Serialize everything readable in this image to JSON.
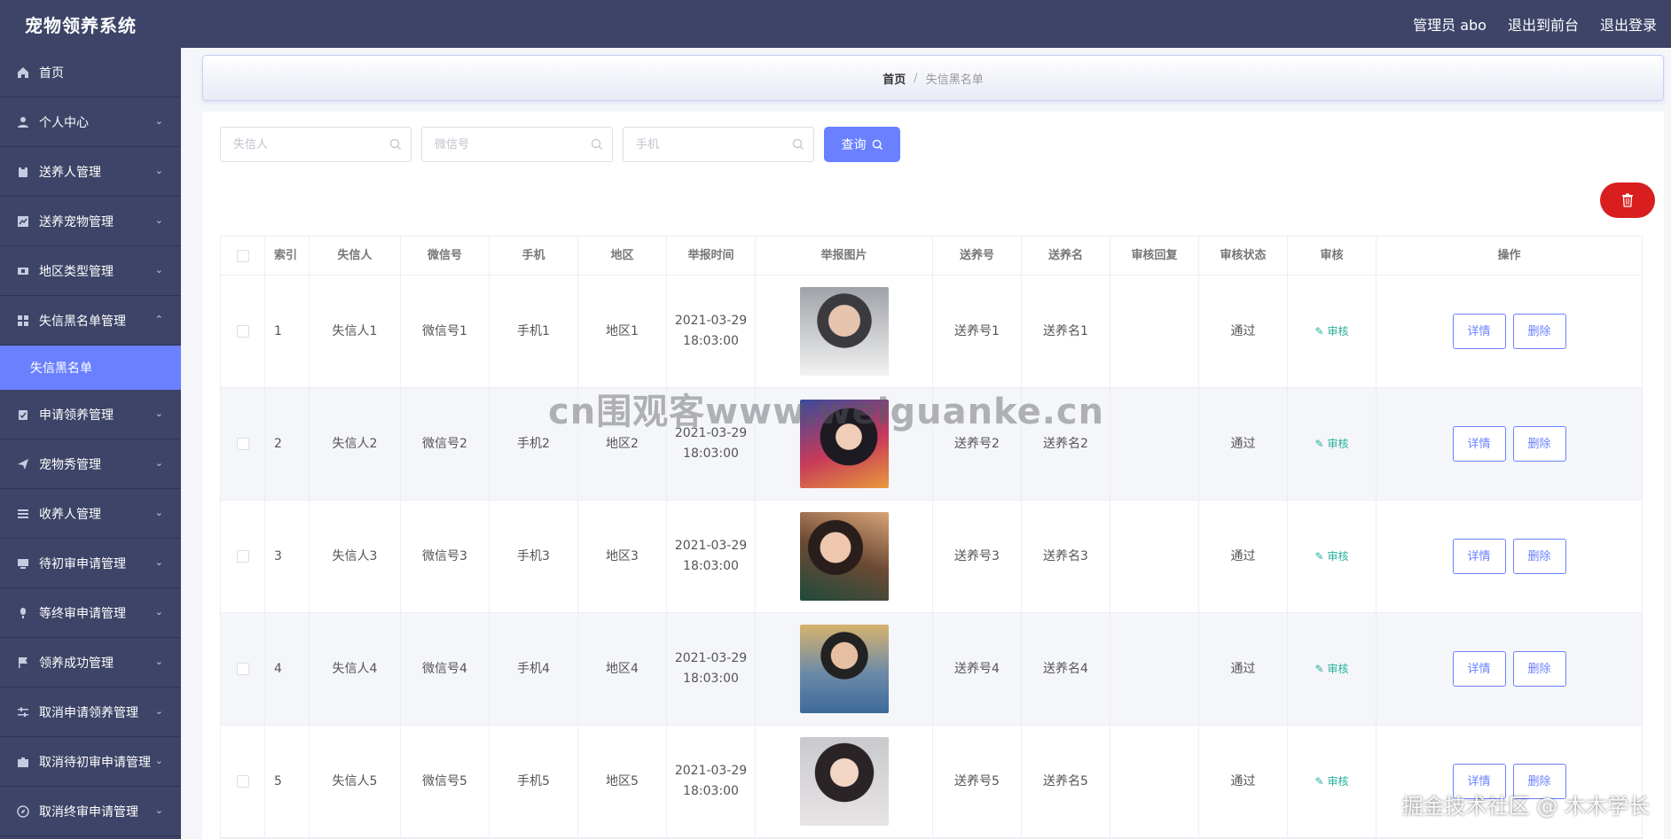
{
  "header": {
    "brand": "宠物领养系统",
    "admin_label": "管理员 abo",
    "to_front": "退出到前台",
    "logout": "退出登录"
  },
  "sidebar": {
    "items": [
      {
        "label": "首页",
        "icon": "home-icon",
        "expandable": false
      },
      {
        "label": "个人中心",
        "icon": "user-icon",
        "expandable": true
      },
      {
        "label": "送养人管理",
        "icon": "clipboard-icon",
        "expandable": true
      },
      {
        "label": "送养宠物管理",
        "icon": "chart-icon",
        "expandable": true
      },
      {
        "label": "地区类型管理",
        "icon": "film-icon",
        "expandable": true
      },
      {
        "label": "失信黑名单管理",
        "icon": "grid-icon",
        "expandable": true,
        "expanded": true
      },
      {
        "label": "申请领养管理",
        "icon": "check-clipboard-icon",
        "expandable": true
      },
      {
        "label": "宠物秀管理",
        "icon": "send-icon",
        "expandable": true
      },
      {
        "label": "收养人管理",
        "icon": "list-icon",
        "expandable": true
      },
      {
        "label": "待初审申请管理",
        "icon": "monitor-icon",
        "expandable": true
      },
      {
        "label": "等终审申请管理",
        "icon": "microphone-icon",
        "expandable": true
      },
      {
        "label": "领养成功管理",
        "icon": "flag-icon",
        "expandable": true
      },
      {
        "label": "取消申请领养管理",
        "icon": "sliders-icon",
        "expandable": true
      },
      {
        "label": "取消待初审申请管理",
        "icon": "briefcase-icon",
        "expandable": true
      },
      {
        "label": "取消终审申请管理",
        "icon": "compass-icon",
        "expandable": true
      }
    ],
    "active_submenu": "失信黑名单"
  },
  "breadcrumb": {
    "home": "首页",
    "separator": "/",
    "current": "失信黑名单"
  },
  "search": {
    "fields": [
      {
        "placeholder": "失信人",
        "value": ""
      },
      {
        "placeholder": "微信号",
        "value": ""
      },
      {
        "placeholder": "手机",
        "value": ""
      }
    ],
    "query_label": "查询"
  },
  "table": {
    "columns": [
      "索引",
      "失信人",
      "微信号",
      "手机",
      "地区",
      "举报时间",
      "举报图片",
      "送养号",
      "送养名",
      "审核回复",
      "审核状态",
      "审核",
      "操作"
    ],
    "audit_label": "审核",
    "detail_label": "详情",
    "delete_label": "删除",
    "rows": [
      {
        "index": "1",
        "person": "失信人1",
        "wechat": "微信号1",
        "phone": "手机1",
        "area": "地区1",
        "date": "2021-03-29",
        "time": "18:03:00",
        "foster_no": "送养号1",
        "foster_name": "送养名1",
        "reply": "",
        "status": "通过"
      },
      {
        "index": "2",
        "person": "失信人2",
        "wechat": "微信号2",
        "phone": "手机2",
        "area": "地区2",
        "date": "2021-03-29",
        "time": "18:03:00",
        "foster_no": "送养号2",
        "foster_name": "送养名2",
        "reply": "",
        "status": "通过"
      },
      {
        "index": "3",
        "person": "失信人3",
        "wechat": "微信号3",
        "phone": "手机3",
        "area": "地区3",
        "date": "2021-03-29",
        "time": "18:03:00",
        "foster_no": "送养号3",
        "foster_name": "送养名3",
        "reply": "",
        "status": "通过"
      },
      {
        "index": "4",
        "person": "失信人4",
        "wechat": "微信号4",
        "phone": "手机4",
        "area": "地区4",
        "date": "2021-03-29",
        "time": "18:03:00",
        "foster_no": "送养号4",
        "foster_name": "送养名4",
        "reply": "",
        "status": "通过"
      },
      {
        "index": "5",
        "person": "失信人5",
        "wechat": "微信号5",
        "phone": "手机5",
        "area": "地区5",
        "date": "2021-03-29",
        "time": "18:03:00",
        "foster_no": "送养号5",
        "foster_name": "送养名5",
        "reply": "",
        "status": "通过"
      }
    ]
  },
  "watermarks": {
    "center": "cn围观客www.weiguanke.cn",
    "bottom_right": "掘金技术社区 @ 木木学长"
  },
  "colors": {
    "header_bg": "#3d4467",
    "accent": "#6b80ff",
    "danger": "#d81e1e",
    "audit_green": "#27b09a"
  }
}
